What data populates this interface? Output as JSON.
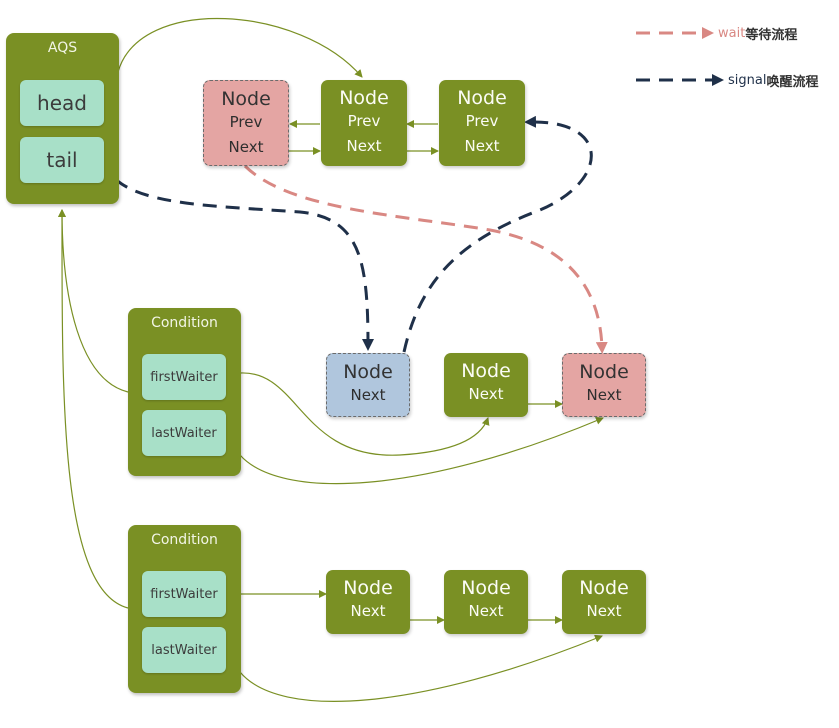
{
  "legend": {
    "wait": {
      "label_en": "wait",
      "label_zh": "等待流程",
      "color": "#d98883"
    },
    "signal": {
      "label_en": "signal",
      "label_zh": "唤醒流程",
      "color": "#1f3049"
    }
  },
  "aqs": {
    "title": "AQS",
    "fields": [
      "head",
      "tail"
    ]
  },
  "sync_queue": [
    {
      "title": "Node",
      "rows": [
        "Prev",
        "Next"
      ],
      "state": "waiting"
    },
    {
      "title": "Node",
      "rows": [
        "Prev",
        "Next"
      ],
      "state": "normal"
    },
    {
      "title": "Node",
      "rows": [
        "Prev",
        "Next"
      ],
      "state": "normal"
    }
  ],
  "conditions": [
    {
      "title": "Condition",
      "fields": [
        "firstWaiter",
        "lastWaiter"
      ],
      "nodes": [
        {
          "title": "Node",
          "rows": [
            "Next"
          ],
          "state": "signaled"
        },
        {
          "title": "Node",
          "rows": [
            "Next"
          ],
          "state": "normal"
        },
        {
          "title": "Node",
          "rows": [
            "Next"
          ],
          "state": "waiting"
        }
      ]
    },
    {
      "title": "Condition",
      "fields": [
        "firstWaiter",
        "lastWaiter"
      ],
      "nodes": [
        {
          "title": "Node",
          "rows": [
            "Next"
          ],
          "state": "normal"
        },
        {
          "title": "Node",
          "rows": [
            "Next"
          ],
          "state": "normal"
        },
        {
          "title": "Node",
          "rows": [
            "Next"
          ],
          "state": "normal"
        }
      ]
    }
  ],
  "colors": {
    "panel": "#7a9024",
    "field": "#a8e0c8",
    "node_waiting": "#e4a5a3",
    "node_signaled": "#b0c6dd",
    "arrow": "#7a9024"
  }
}
